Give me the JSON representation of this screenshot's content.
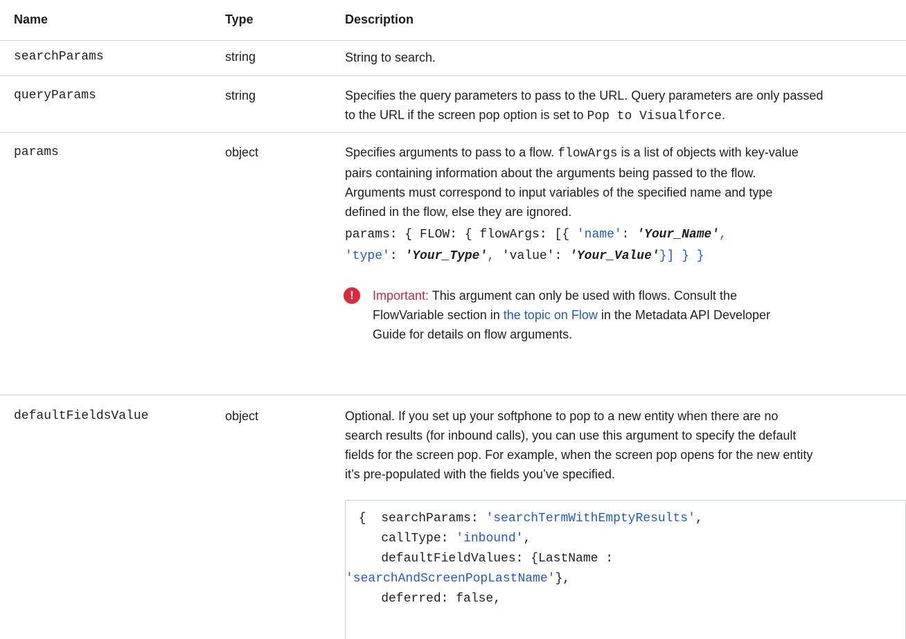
{
  "table": {
    "headers": {
      "name": "Name",
      "type": "Type",
      "description": "Description"
    },
    "rows": {
      "searchParams": {
        "name": "searchParams",
        "type": "string",
        "description": "String to search."
      },
      "queryParams": {
        "name": "queryParams",
        "type": "string",
        "desc_line1": "Specifies the query parameters to pass to the URL. Query parameters are only passed",
        "desc_line2_a": "to the URL if the screen pop option is set to",
        "desc_line2_code": "Pop to Visualforce",
        "desc_line2_b": "."
      },
      "params": {
        "name": "params",
        "type": "object",
        "desc_line1_a": "Specifies arguments to pass to a flow.",
        "desc_line1_code": "flowArgs",
        "desc_line1_b": "is a list of objects with key-value",
        "desc_line2": "pairs containing information about the arguments being passed to the flow.",
        "desc_line3": "Arguments must correspond to input variables of the specified name and type",
        "desc_line4": "defined in the flow, else they are ignored.",
        "code1": {
          "p1": "params: { FLOW: { flowArgs: [{ ",
          "p2": "'name'",
          "p3": ": ",
          "p4": "'Your_Name'",
          "p5": ","
        },
        "code2": {
          "p1": "'type'",
          "p2": ": ",
          "p3": "'Your_Type'",
          "p4": ", ",
          "p5": "'value':  ",
          "p6": "'Your_Value'",
          "p7": "}] } }"
        },
        "important": {
          "label": "Important:",
          "line1": "This argument can only be used with flows. Consult the",
          "line2_a": "FlowVariable section in",
          "line2_link": "the topic on Flow",
          "line2_b": "in the Metadata API Developer",
          "line3": "Guide for details on flow arguments."
        }
      },
      "defaultFieldsValue": {
        "name": "defaultFieldsValue",
        "type": "object",
        "desc_line1": "Optional. If you set up your softphone to pop to a new entity when there are no",
        "desc_line2": "search results (for inbound calls), you can use this argument to specify the default",
        "desc_line3": "fields for the screen pop. For example, when the screen pop opens for the new entity",
        "desc_line4": "it’s pre-populated with the fields you’ve specified.",
        "code": {
          "l1a": " {  searchParams: ",
          "l1b": "'searchTermWithEmptyResults'",
          "l1c": ",",
          "l2a": "    callType: ",
          "l2b": "'inbound'",
          "l2c": ",",
          "l3": "    defaultFieldValues: {LastName :",
          "l4a": "'searchAndScreenPopLastName'",
          "l4b": "},",
          "l5": "    deferred: false,"
        }
      }
    }
  },
  "colors": {
    "link": "#1e5ad6",
    "important": "#c8283c",
    "icon": "#e0283c"
  },
  "icons": {
    "important": "exclamation-circle-icon"
  }
}
